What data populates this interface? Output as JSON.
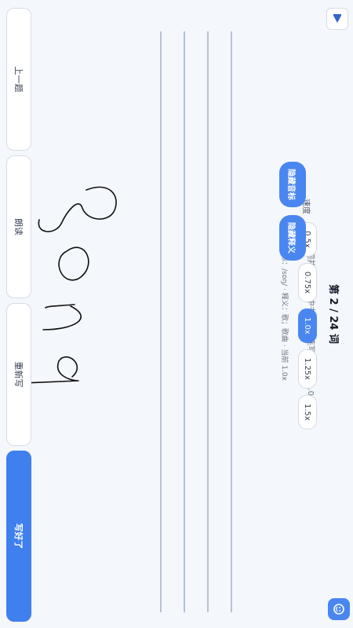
{
  "header": {
    "progress": "第 2 / 24 词",
    "hint": "请听单词并在四线格中书写（可连写），当前 1.0x"
  },
  "controls": {
    "speed_label": "速度",
    "speeds": [
      "0.5x",
      "0.75x",
      "1.0x",
      "1.25x",
      "1.5x"
    ],
    "selected_speed": "1.0x",
    "hide_phonetic": "隐藏音标",
    "hide_meaning": "隐藏释义"
  },
  "info": {
    "line": "音标：/sɒŋ/ · 释义：歌；歌曲 · 当前 1.0x"
  },
  "actions": {
    "prev": "上一题",
    "replay": "朗读",
    "rewrite": "重新写",
    "done": "写好了"
  },
  "icons": {
    "play": "play-icon",
    "assist": "assistant-icon"
  },
  "colors": {
    "accent": "#4a86f0",
    "ink": "#111827",
    "line": "#6b86b6"
  }
}
